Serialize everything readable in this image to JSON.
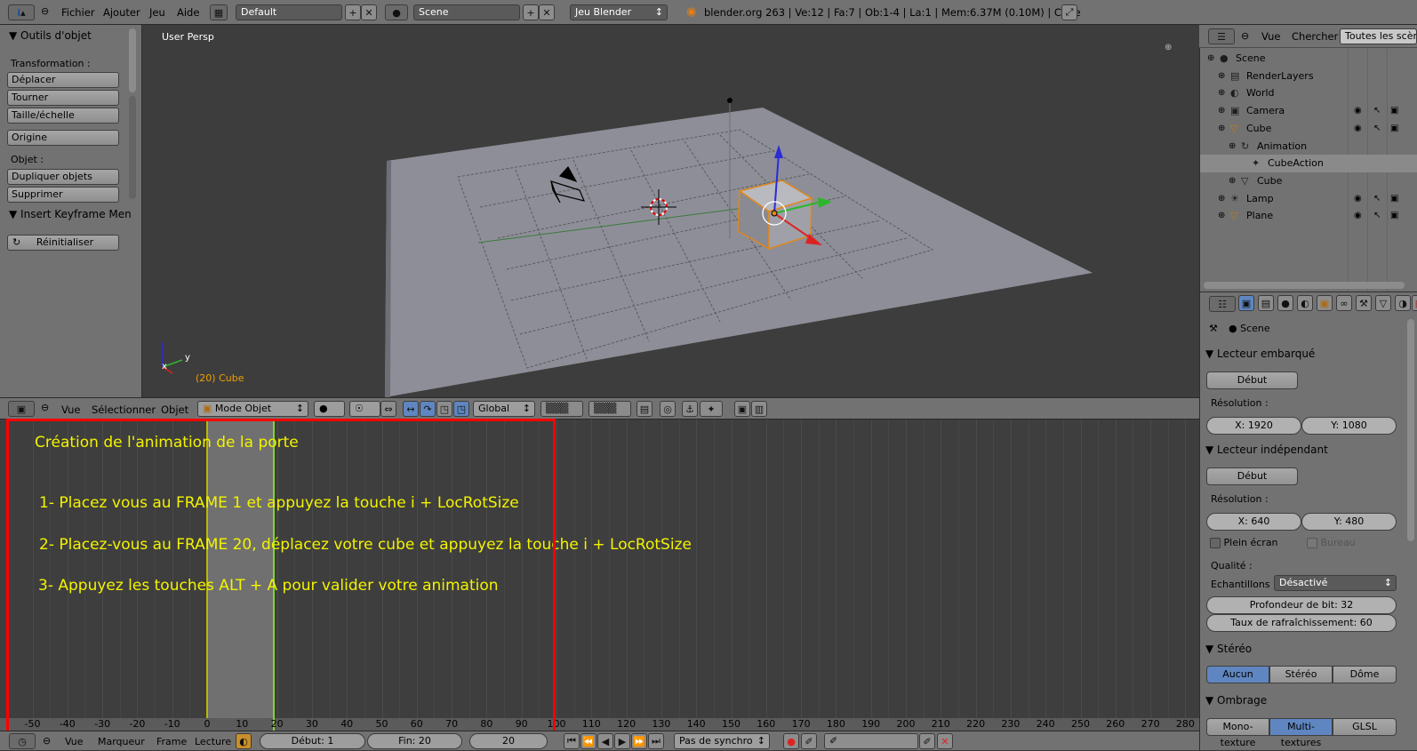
{
  "topbar": {
    "menus": [
      "Fichier",
      "Ajouter",
      "Jeu",
      "Aide"
    ],
    "layout": "Default",
    "scene": "Scene",
    "engine": "Jeu Blender",
    "status": "blender.org 263 | Ve:12 | Fa:7 | Ob:1-4 | La:1 | Mem:6.37M (0.10M) | Cube"
  },
  "toolshelf": {
    "title": "Outils d'objet",
    "transform_label": "Transformation :",
    "move": "Déplacer",
    "rotate": "Tourner",
    "scale": "Taille/échelle",
    "origin": "Origine",
    "object_label": "Objet :",
    "duplicate": "Dupliquer objets",
    "delete": "Supprimer",
    "keyframe_panel": "Insert Keyframe Men",
    "reset": "Réinitialiser"
  },
  "viewport": {
    "view_label": "User Persp",
    "object_label": "(20) Cube",
    "axis_y": "y",
    "axis_x": "x"
  },
  "viewport_header": {
    "menus": [
      "Vue",
      "Sélectionner",
      "Objet"
    ],
    "mode": "Mode Objet",
    "orientation": "Global"
  },
  "instructions": {
    "title": "Création de l'animation de la porte",
    "step1": "1- Placez vous au FRAME 1 et appuyez la touche i + LocRotSize",
    "step2": "2- Placez-vous au FRAME 20, déplacez votre cube et appuyez la touche i + LocRotSize",
    "step3": "3- Appuyez les touches ALT + A pour valider votre animation"
  },
  "timeline": {
    "ticks": [
      "-50",
      "-40",
      "-30",
      "-20",
      "-10",
      "0",
      "10",
      "20",
      "30",
      "40",
      "50",
      "60",
      "70",
      "80",
      "90",
      "100",
      "110",
      "120",
      "130",
      "140",
      "150",
      "160",
      "170",
      "180",
      "190",
      "200",
      "210",
      "220",
      "230",
      "240",
      "250",
      "260",
      "270",
      "280"
    ],
    "menus": [
      "Vue",
      "Marqueur",
      "Frame",
      "Lecture"
    ],
    "start": "Début: 1",
    "end": "Fin: 20",
    "current": "20",
    "sync": "Pas de synchro"
  },
  "outliner": {
    "menus": [
      "Vue",
      "Chercher"
    ],
    "filter": "Toutes les scènes",
    "rows": [
      {
        "label": "Scene",
        "indent": 0
      },
      {
        "label": "RenderLayers",
        "indent": 1
      },
      {
        "label": "World",
        "indent": 1
      },
      {
        "label": "Camera",
        "indent": 1
      },
      {
        "label": "Cube",
        "indent": 1
      },
      {
        "label": "Animation",
        "indent": 2
      },
      {
        "label": "CubeAction",
        "indent": 3
      },
      {
        "label": "Cube",
        "indent": 2
      },
      {
        "label": "Lamp",
        "indent": 1
      },
      {
        "label": "Plane",
        "indent": 1
      }
    ]
  },
  "properties": {
    "context": "Scene",
    "embedded_player": "Lecteur embarqué",
    "start_button": "Début",
    "resolution_label": "Résolution :",
    "res_x": "X: 1920",
    "res_y": "Y: 1080",
    "standalone_player": "Lecteur indépendant",
    "start_button2": "Début",
    "resolution_label2": "Résolution :",
    "res_x2": "X: 640",
    "res_y2": "Y: 480",
    "fullscreen": "Plein écran",
    "desktop": "Bureau",
    "quality_label": "Qualité :",
    "samples_label": "Echantillons",
    "samples_value": "Désactivé",
    "bit_depth": "Profondeur de bit: 32",
    "refresh_rate": "Taux de rafraîchissement: 60",
    "stereo": "Stéréo",
    "stereo_options": [
      "Aucun",
      "Stéréo",
      "Dôme"
    ],
    "shading": "Ombrage",
    "shading_options": [
      "Mono-texture",
      "Multi-textures",
      "GLSL"
    ]
  }
}
